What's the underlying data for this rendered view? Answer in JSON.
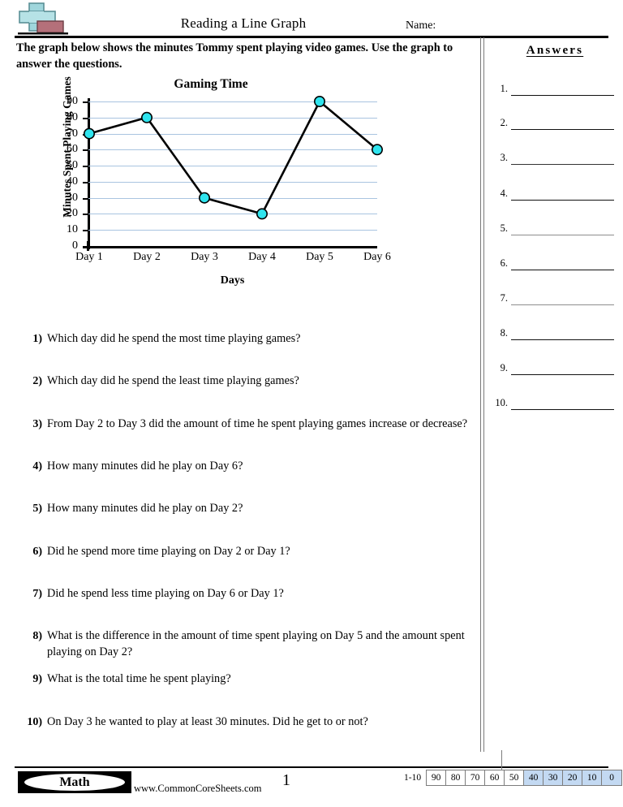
{
  "header": {
    "title": "Reading a Line Graph",
    "name_label": "Name:",
    "logo_icon": "plus-block-logo"
  },
  "instructions": "The graph below shows the minutes Tommy spent playing video games. Use the graph to answer the questions.",
  "answers": {
    "heading": "Answers",
    "items": [
      "1.",
      "2.",
      "3.",
      "4.",
      "5.",
      "6.",
      "7.",
      "8.",
      "9.",
      "10."
    ]
  },
  "chart_data": {
    "type": "line",
    "title": "Gaming Time",
    "xlabel": "Days",
    "ylabel": "Minutes Spent Playing Games",
    "categories": [
      "Day 1",
      "Day 2",
      "Day 3",
      "Day 4",
      "Day 5",
      "Day 6"
    ],
    "values": [
      70,
      80,
      30,
      20,
      90,
      60
    ],
    "yticks": [
      90,
      80,
      70,
      60,
      50,
      40,
      30,
      20,
      10,
      0
    ],
    "ylim": [
      0,
      90
    ],
    "grid": true,
    "legend": false,
    "marker_color": "#2fe4ee",
    "marker_edge_color": "#000000",
    "line_color": "#000000",
    "gridline_color": "#a9c4e0"
  },
  "questions": [
    {
      "num": "1)",
      "text": "Which day did he spend the most time playing games?"
    },
    {
      "num": "2)",
      "text": "Which day did he spend the least time playing games?"
    },
    {
      "num": "3)",
      "text": "From Day 2 to Day 3 did the amount of time he spent playing games increase or decrease?"
    },
    {
      "num": "4)",
      "text": "How many minutes did he play on Day 6?"
    },
    {
      "num": "5)",
      "text": "How many minutes did he play on Day 2?"
    },
    {
      "num": "6)",
      "text": "Did he spend more time playing on Day 2 or Day 1?"
    },
    {
      "num": "7)",
      "text": "Did he spend less time playing on Day 6 or Day 1?"
    },
    {
      "num": "8)",
      "text": "What is the difference in the amount of time spent playing on Day 5 and the amount spent playing on Day 2?"
    },
    {
      "num": "9)",
      "text": "What is the total time he spent playing?"
    },
    {
      "num": "10)",
      "text": "On Day 3 he wanted to play at least 30 minutes. Did he get to or not?"
    }
  ],
  "footer": {
    "badge_label": "Math",
    "site_url": "www.CommonCoreSheets.com",
    "page_number": "1",
    "scale_label": "1-10",
    "scale_cells": [
      {
        "value": "90",
        "highlighted": false
      },
      {
        "value": "80",
        "highlighted": false
      },
      {
        "value": "70",
        "highlighted": false
      },
      {
        "value": "60",
        "highlighted": false
      },
      {
        "value": "50",
        "highlighted": false
      },
      {
        "value": "40",
        "highlighted": true
      },
      {
        "value": "30",
        "highlighted": true
      },
      {
        "value": "20",
        "highlighted": true
      },
      {
        "value": "10",
        "highlighted": true
      },
      {
        "value": "0",
        "highlighted": true
      }
    ]
  }
}
